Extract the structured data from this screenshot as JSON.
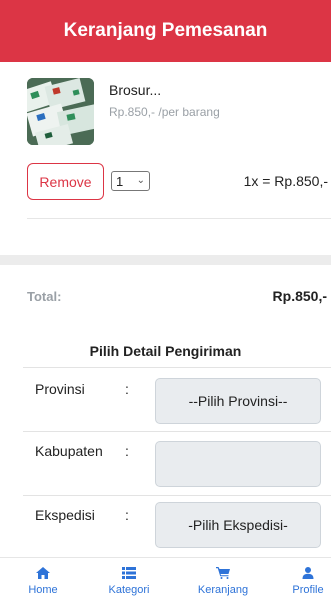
{
  "header": {
    "title": "Keranjang Pemesanan"
  },
  "cart_item": {
    "name": "Brosur...",
    "price": "Rp.850,- /per barang",
    "remove_label": "Remove",
    "quantity": "1",
    "subtotal": "1x = Rp.850,-"
  },
  "summary": {
    "total_label": "Total:",
    "total_value": "Rp.850,-"
  },
  "shipping": {
    "title": "Pilih Detail Pengiriman",
    "provinsi": {
      "label": "Provinsi",
      "colon": ":",
      "value": "--Pilih Provinsi--"
    },
    "kabupaten": {
      "label": "Kabupaten",
      "colon": ":",
      "value": ""
    },
    "ekspedisi": {
      "label": "Ekspedisi",
      "colon": ":",
      "value": "-Pilih Ekspedisi-"
    }
  },
  "bottom_nav": {
    "home": {
      "label": "Home",
      "icon": "home-icon"
    },
    "kategori": {
      "label": "Kategori",
      "icon": "list-icon"
    },
    "keranjang": {
      "label": "Keranjang",
      "icon": "cart-icon"
    },
    "profile": {
      "label": "Profile",
      "icon": "user-icon"
    }
  },
  "colors": {
    "accent": "#dc3545",
    "nav_active": "#2e73d8"
  }
}
